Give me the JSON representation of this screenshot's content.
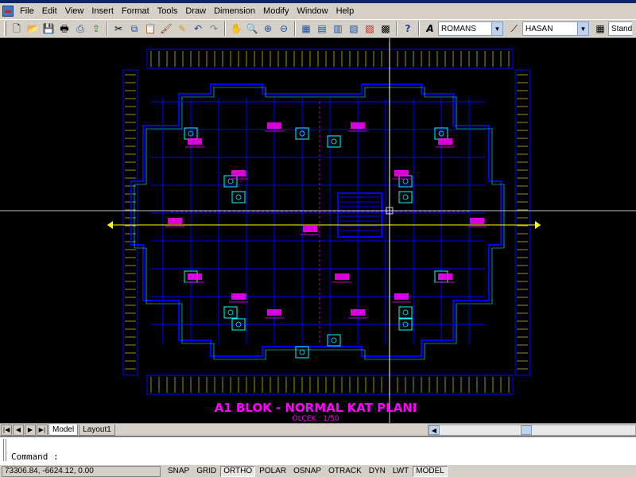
{
  "menu": [
    "File",
    "Edit",
    "View",
    "Insert",
    "Format",
    "Tools",
    "Draw",
    "Dimension",
    "Modify",
    "Window",
    "Help"
  ],
  "toolbar": {
    "text_style": "ROMANS",
    "dim_style": "HASAN",
    "table_style": "Stand"
  },
  "drawing": {
    "title": "A1 BLOK - NORMAL KAT PLANI",
    "scale": "ÖLÇEK : 1/50",
    "colors": {
      "background": "#000000",
      "walls": "#0000ff",
      "annotation": "#ff00ff",
      "dimension": "#ffff00",
      "fixtures": "#00ffff"
    }
  },
  "tabs": {
    "model": "Model",
    "layout1": "Layout1"
  },
  "command": {
    "prompt": "Command :"
  },
  "status": {
    "coordinates": "73306.84, -6624.12, 0.00",
    "toggles": [
      "SNAP",
      "GRID",
      "ORTHO",
      "POLAR",
      "OSNAP",
      "OTRACK",
      "DYN",
      "LWT",
      "MODEL"
    ]
  }
}
